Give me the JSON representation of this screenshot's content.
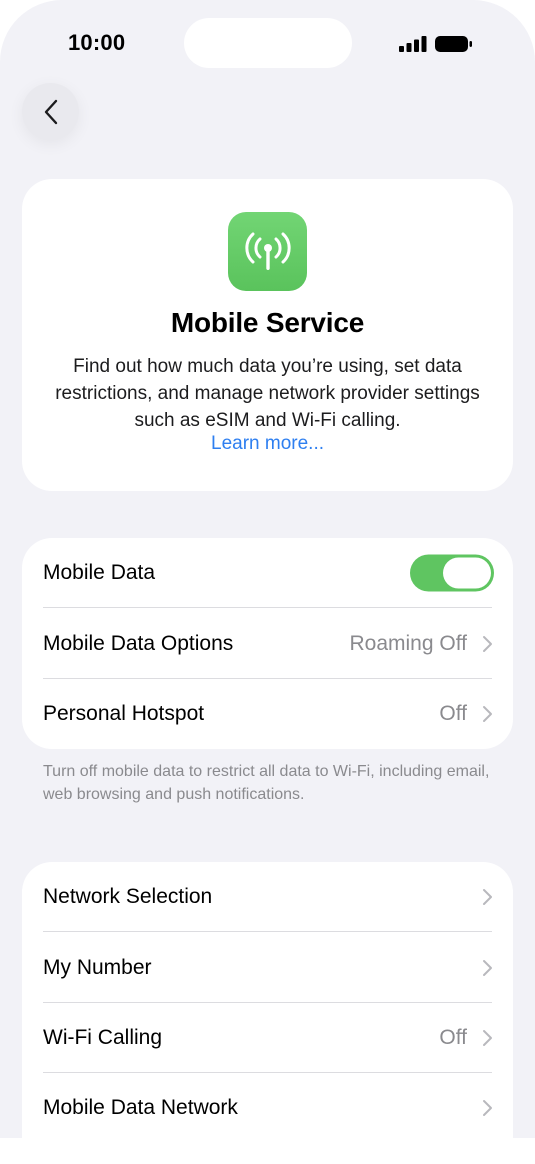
{
  "status_bar": {
    "time": "10:00"
  },
  "header": {
    "back_icon": "chevron-left-icon"
  },
  "hero": {
    "icon": "antenna-icon",
    "icon_color": "#5fc561",
    "title": "Mobile Service",
    "description": "Find out how much data you’re using, set data restrictions, and manage network provider settings such as eSIM and Wi-Fi calling.",
    "link": "Learn more..."
  },
  "group1": {
    "rows": [
      {
        "label": "Mobile Data",
        "toggle_on": true
      },
      {
        "label": "Mobile Data Options",
        "value": "Roaming Off"
      },
      {
        "label": "Personal Hotspot",
        "value": "Off"
      }
    ],
    "footnote": "Turn off mobile data to restrict all data to Wi-Fi, including email, web browsing and push notifications."
  },
  "group2": {
    "rows": [
      {
        "label": "Network Selection",
        "value": ""
      },
      {
        "label": "My Number",
        "value": ""
      },
      {
        "label": "Wi-Fi Calling",
        "value": "Off"
      },
      {
        "label": "Mobile Data Network",
        "value": ""
      }
    ]
  },
  "colors": {
    "accent": "#2e7ff0",
    "toggle_on": "#5fc561",
    "background": "#f2f2f7"
  }
}
